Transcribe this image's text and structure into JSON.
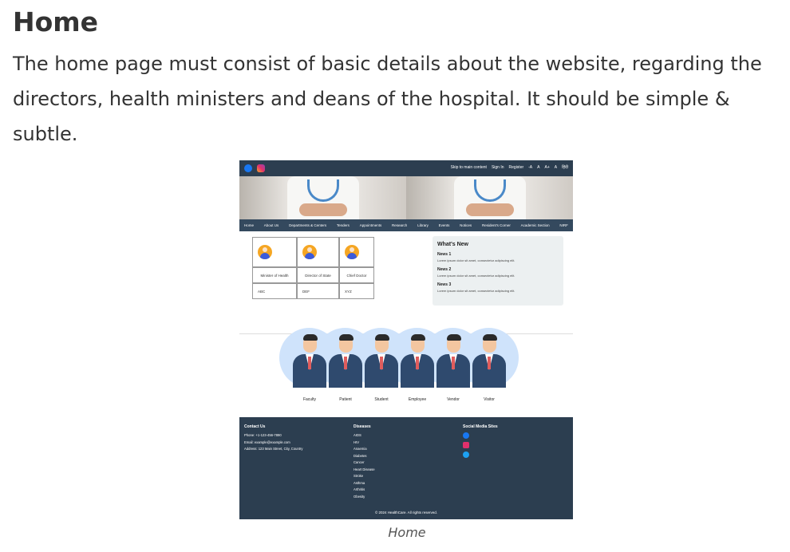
{
  "doc": {
    "title": "Home",
    "paragraph": "The home page must consist of basic details about the website, regarding the directors, health ministers and deans of the hospital. It should be simple & subtle.",
    "caption": "Home"
  },
  "topbar": {
    "links": [
      "Skip to main content",
      "Sign In",
      "Register",
      "-A",
      "A",
      "A+",
      "A",
      "हिंदी"
    ],
    "icons": [
      "facebook-icon",
      "instagram-icon"
    ]
  },
  "nav": {
    "items": [
      "Home",
      "About Us",
      "Departments & Centers",
      "Tenders",
      "Appointments",
      "Research",
      "Library",
      "Events",
      "Notices",
      "Resident's Corner",
      "Academic Section",
      "NIRF"
    ]
  },
  "officials": {
    "roles": [
      "Minister of Health",
      "Director of State",
      "Chief Doctor"
    ],
    "names": [
      "ABC",
      "DEF",
      "XYZ"
    ]
  },
  "news": {
    "title": "What's New",
    "items": [
      {
        "title": "News 1",
        "text": "Lorem ipsum dolor sit amet, consectetur adipiscing elit."
      },
      {
        "title": "News 2",
        "text": "Lorem ipsum dolor sit amet, consectetur adipiscing elit."
      },
      {
        "title": "News 3",
        "text": "Lorem ipsum dolor sit amet, consectetur adipiscing elit."
      }
    ]
  },
  "user_types": [
    "Faculty",
    "Patient",
    "Student",
    "Employee",
    "Vendor",
    "Visitor"
  ],
  "footer": {
    "contact": {
      "title": "Contact Us",
      "phone": "Phone: +1-123-456-7890",
      "email": "Email: example@example.com",
      "address": "Address: 123 Main Street, City, Country"
    },
    "diseases": {
      "title": "Diseases",
      "items": [
        "AIDS",
        "HIV",
        "Anaemia",
        "Diabetes",
        "Cancer",
        "Heart Disease",
        "Stroke",
        "Asthma",
        "Arthritis",
        "Obesity"
      ]
    },
    "social": {
      "title": "Social Media Sites",
      "icons": [
        "facebook-icon",
        "instagram-icon",
        "twitter-icon"
      ]
    },
    "copyright": "© 2024 HealthCare. All rights reserved."
  },
  "colors": {
    "header_bg": "#2c3e50",
    "nav_bg": "#34495e",
    "news_bg": "#ecf0f1",
    "facebook": "#1877f2",
    "twitter": "#1da1f2"
  }
}
